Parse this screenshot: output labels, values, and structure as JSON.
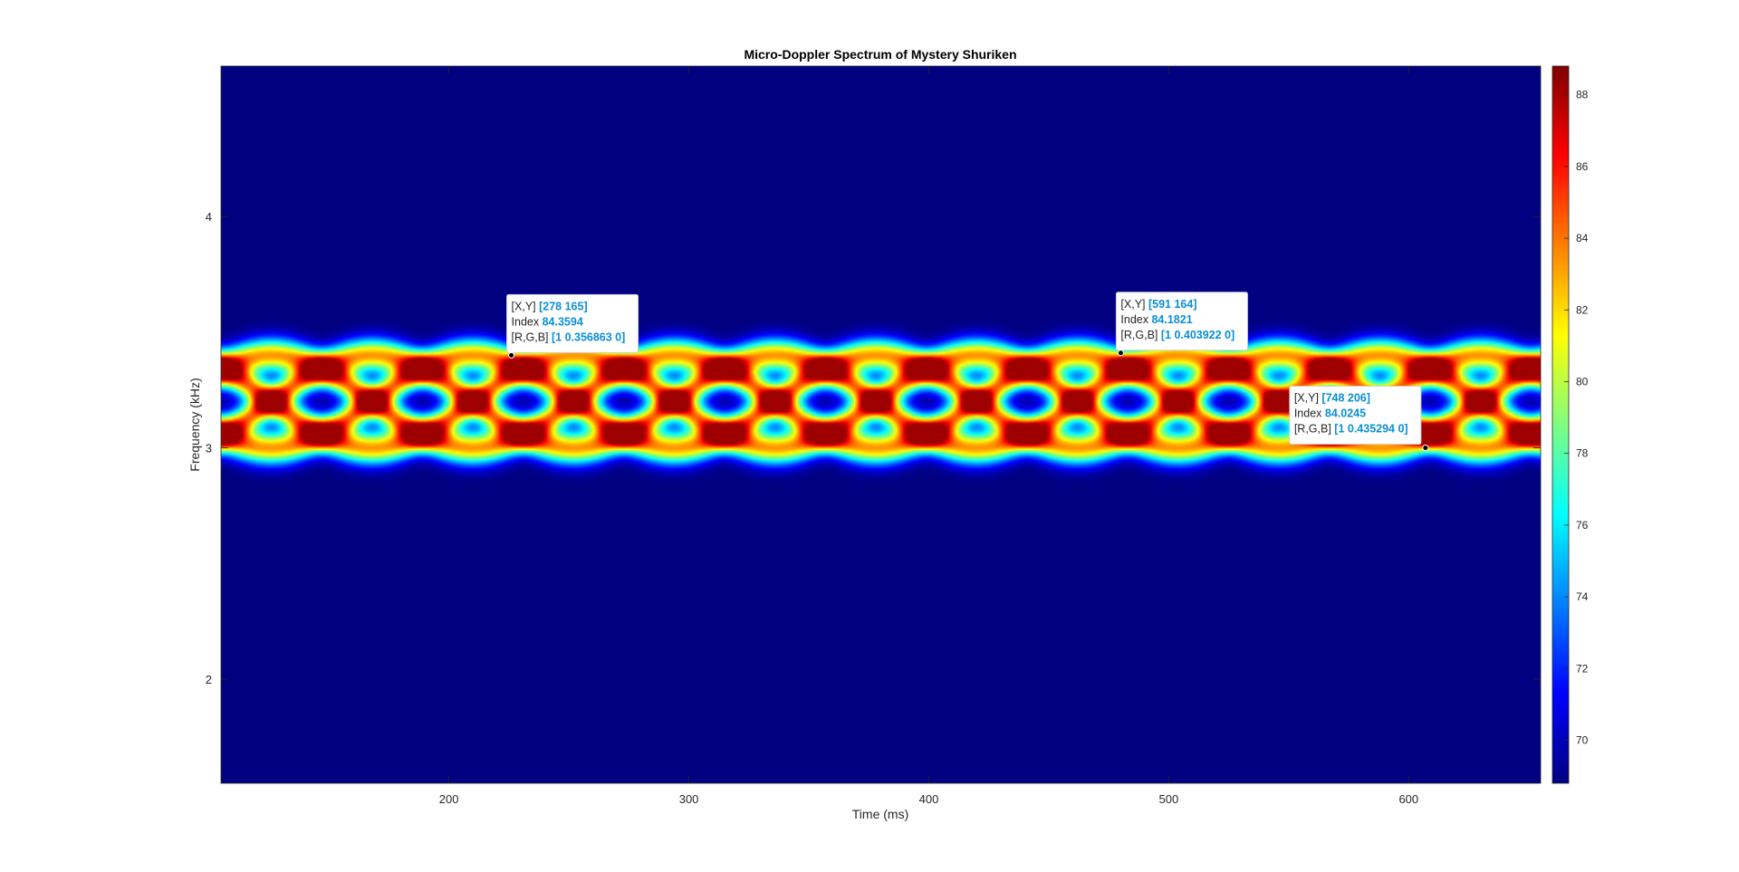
{
  "chart_data": {
    "type": "heatmap",
    "title": "Micro-Doppler Spectrum of Mystery Shuriken",
    "xlabel": "Time (ms)",
    "ylabel": "Frequency (kHz)",
    "xlim": [
      105,
      655
    ],
    "ylim": [
      1.55,
      4.65
    ],
    "xticks": [
      200,
      300,
      400,
      500,
      600
    ],
    "yticks": [
      2,
      3,
      4
    ],
    "colormap": "jet",
    "clim": [
      68.8,
      88.8
    ],
    "colorbar_ticks": [
      70,
      72,
      74,
      76,
      78,
      80,
      82,
      84,
      86,
      88
    ],
    "background_color": "#00007f",
    "pattern": {
      "description": "Four phase-shifted sinusoidal traces forming a braided band",
      "center_khz": 3.2,
      "amplitude_khz": 0.2,
      "period_ms": 168,
      "peak_value": 88.5
    },
    "datatips": [
      {
        "x": 226,
        "y": 3.4,
        "xy_text": "[278 165]",
        "index_text": "84.3594",
        "rgb_text": "[1 0.356863 0]"
      },
      {
        "x": 480,
        "y": 3.41,
        "xy_text": "[591 164]",
        "index_text": "84.1821",
        "rgb_text": "[1 0.403922 0]"
      },
      {
        "x": 607,
        "y": 3.0,
        "xy_text": "[748 206]",
        "index_text": "84.0245",
        "rgb_text": "[1 0.435294 0]"
      }
    ],
    "datatip_keys": {
      "xy": "[X,Y]",
      "index": "Index",
      "rgb": "[R,G,B]"
    },
    "grid": false
  }
}
